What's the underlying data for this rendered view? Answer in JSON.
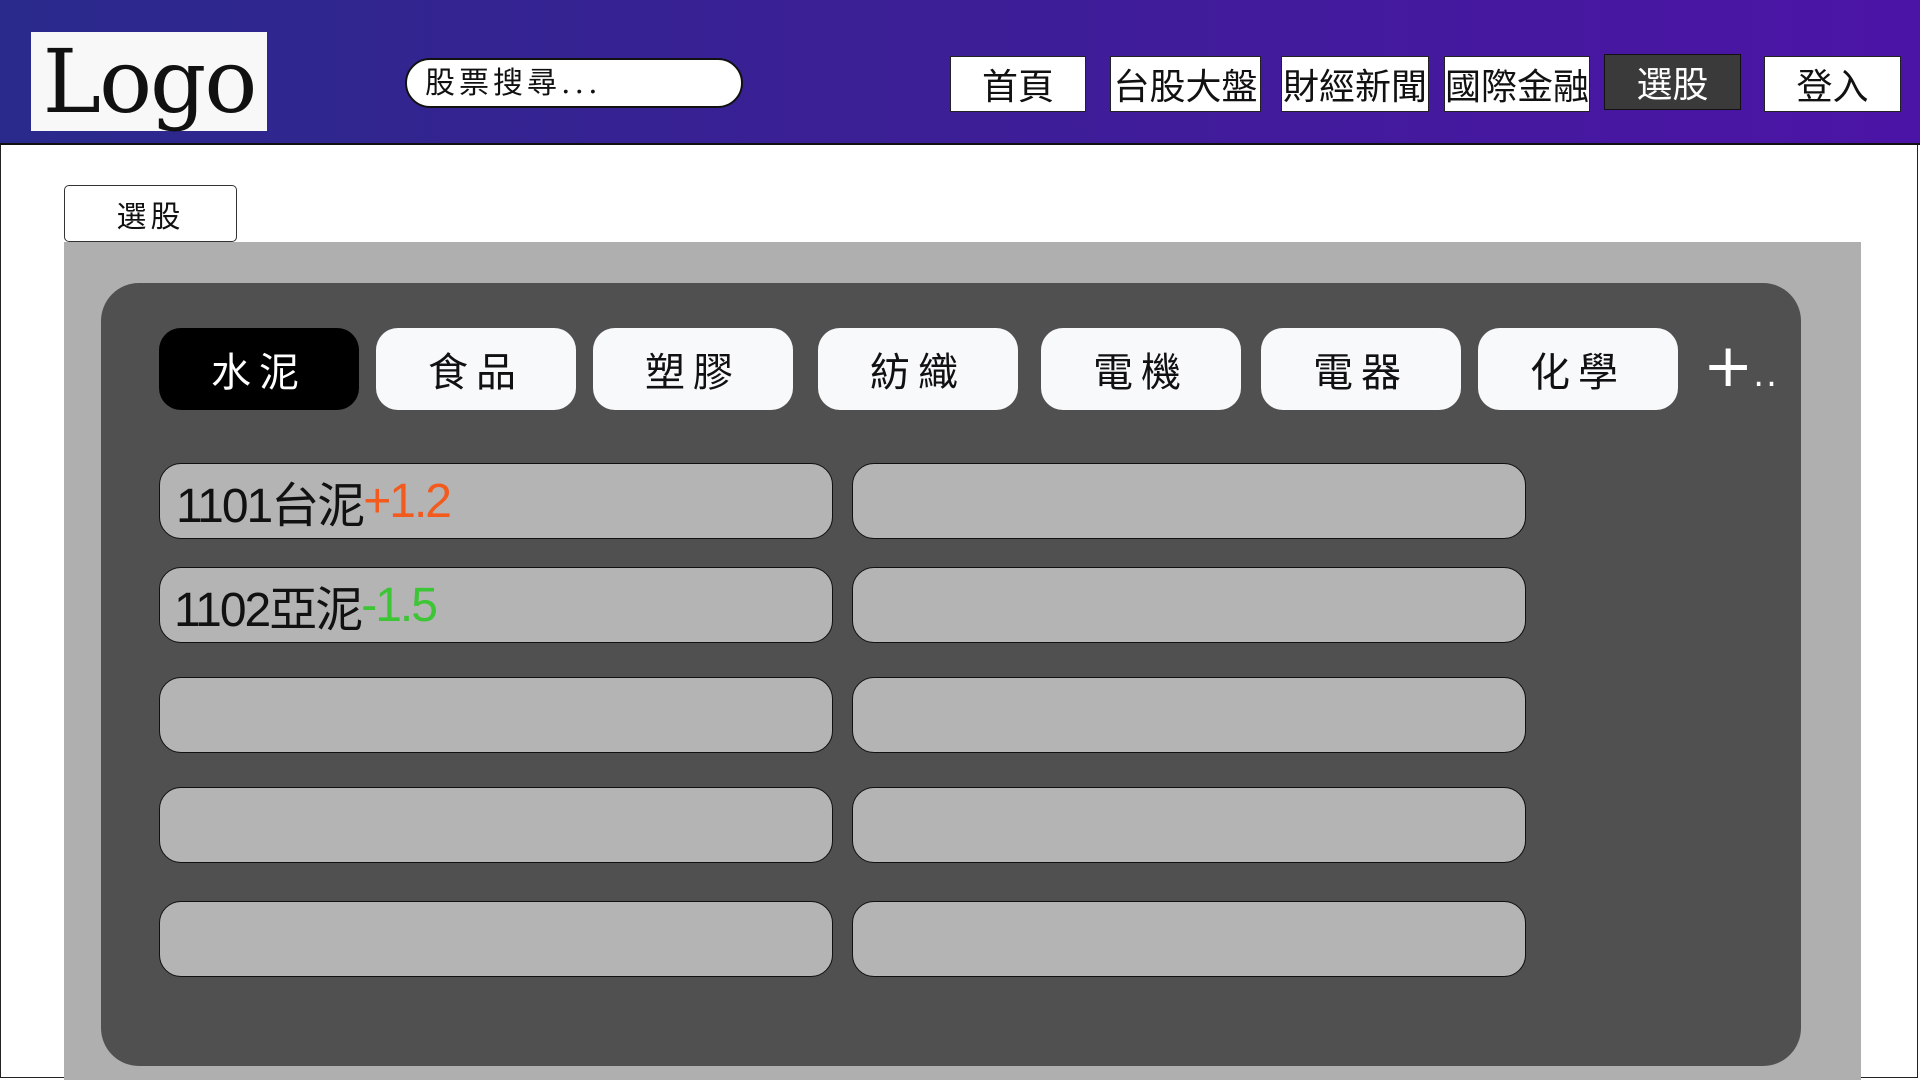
{
  "header": {
    "logo_text": "Logo",
    "search_placeholder": "股票搜尋...",
    "nav": [
      {
        "label": "首頁"
      },
      {
        "label": "台股大盤"
      },
      {
        "label": "財經新聞"
      },
      {
        "label": "國際金融"
      },
      {
        "label": "選股",
        "active": true
      },
      {
        "label": "登入"
      }
    ]
  },
  "page": {
    "section_label": "選股"
  },
  "categories": {
    "tabs": [
      {
        "label": "水泥",
        "active": true
      },
      {
        "label": "食品"
      },
      {
        "label": "塑膠"
      },
      {
        "label": "紡織"
      },
      {
        "label": "電機"
      },
      {
        "label": "電器"
      },
      {
        "label": "化學"
      }
    ],
    "more_label": "+",
    "more_dots": ".."
  },
  "stocks": [
    {
      "code_name": "1101台泥",
      "change": "+1.2",
      "direction": "up"
    },
    {
      "code_name": "1102亞泥",
      "change": "-1.5",
      "direction": "down"
    }
  ],
  "colors": {
    "up": "#f25a1e",
    "down": "#3cc534",
    "header_gradient_start": "#2a2a8c",
    "header_gradient_end": "#4c14a6"
  }
}
